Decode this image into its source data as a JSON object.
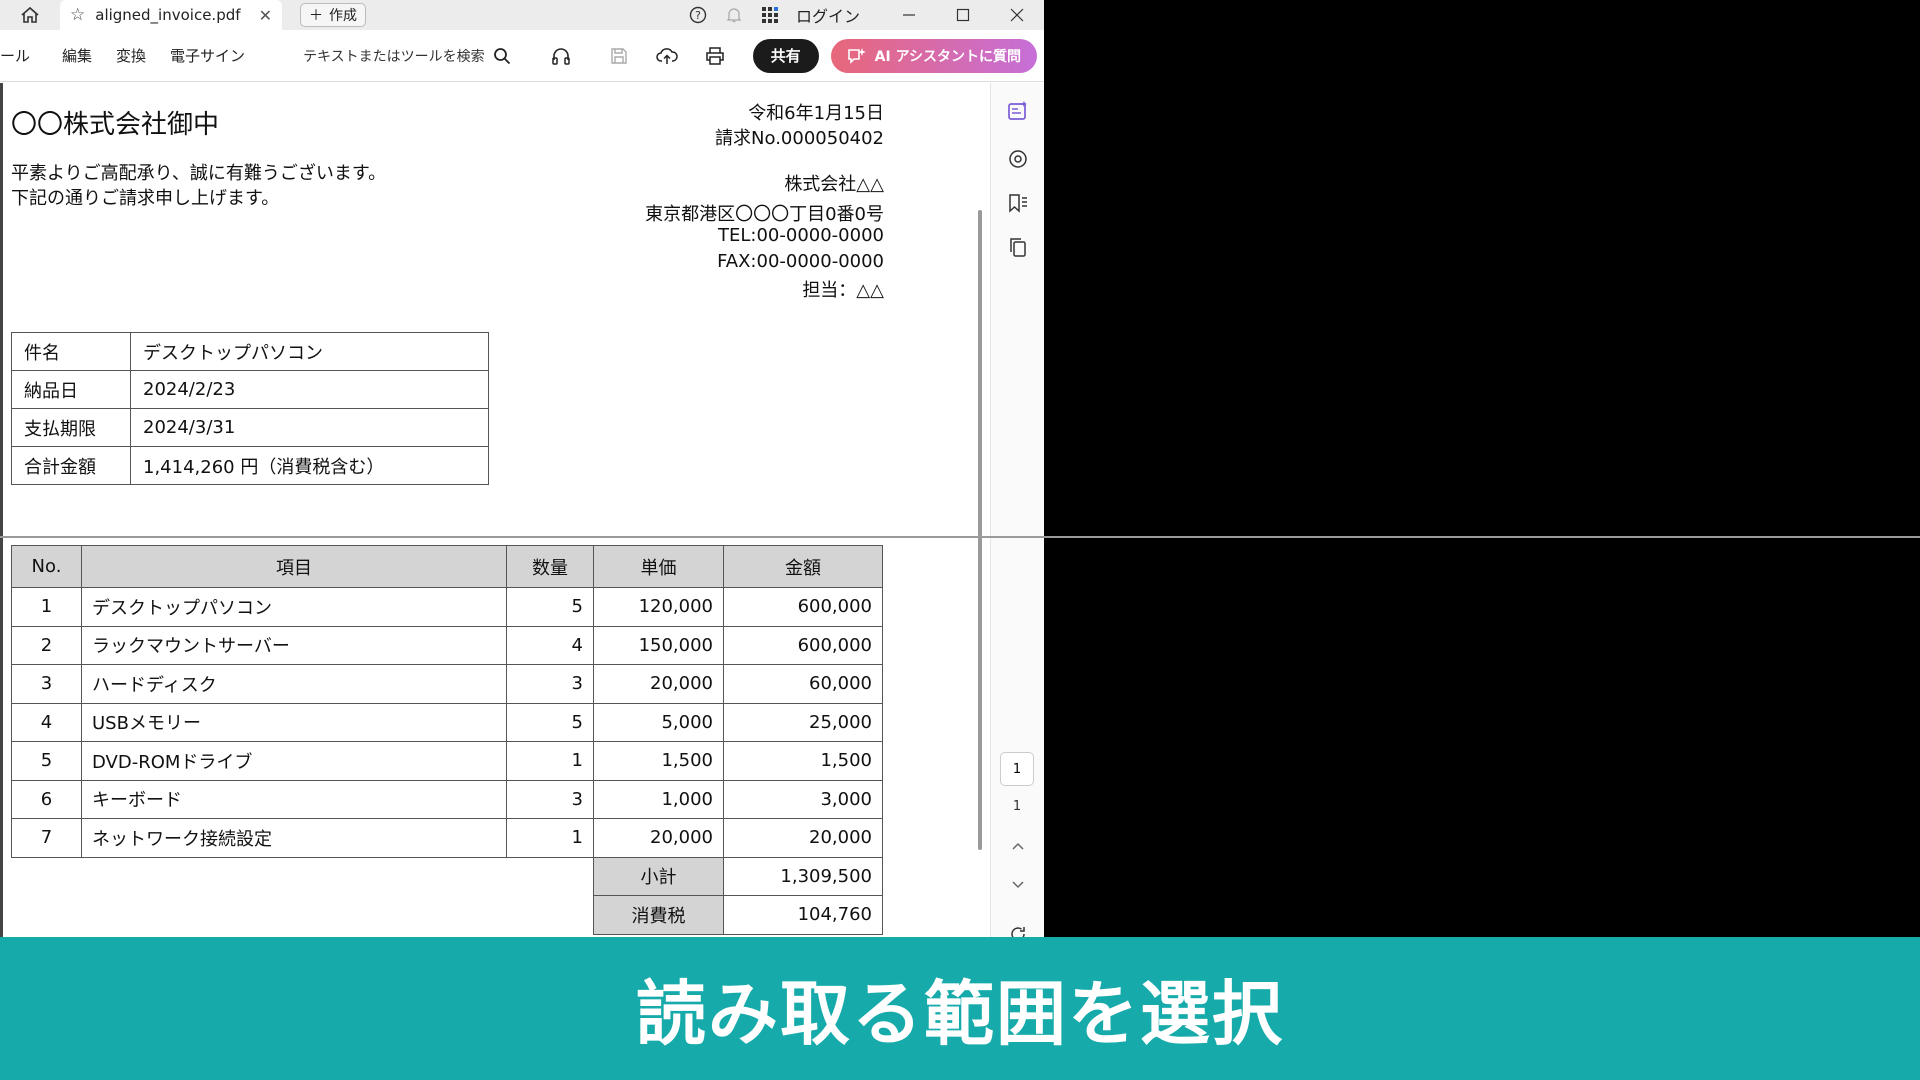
{
  "titlebar": {
    "tab_title": "aligned_invoice.pdf",
    "new_tab": "作成",
    "login": "ログイン"
  },
  "toolbar": {
    "menu": [
      "ール",
      "編集",
      "変換",
      "電子サイン"
    ],
    "search_placeholder": "テキストまたはツールを検索",
    "share": "共有",
    "ai": "AI アシスタントに質問"
  },
  "invoice": {
    "addressee": "〇〇株式会社御中",
    "date": "令和6年1月15日",
    "number": "請求No.000050402",
    "greeting1": "平素よりご高配承り、誠に有難うございます。",
    "greeting2": "下記の通りご請求申し上げます。",
    "company": "株式会社△△",
    "address": "東京都港区〇〇〇丁目0番0号",
    "tel": "TEL:00-0000-0000",
    "fax": "FAX:00-0000-0000",
    "contact": "担当：△△",
    "info": [
      {
        "label": "件名",
        "value": "デスクトップパソコン"
      },
      {
        "label": "納品日",
        "value": "2024/2/23"
      },
      {
        "label": "支払期限",
        "value": "2024/3/31"
      },
      {
        "label": "合計金額",
        "value": "1,414,260 円（消費税含む）"
      }
    ],
    "headers": {
      "no": "No.",
      "item": "項目",
      "qty": "数量",
      "price": "単価",
      "amount": "金額"
    },
    "rows": [
      {
        "no": "1",
        "item": "デスクトップパソコン",
        "qty": "5",
        "price": "120,000",
        "amount": "600,000"
      },
      {
        "no": "2",
        "item": "ラックマウントサーバー",
        "qty": "4",
        "price": "150,000",
        "amount": "600,000"
      },
      {
        "no": "3",
        "item": "ハードディスク",
        "qty": "3",
        "price": "20,000",
        "amount": "60,000"
      },
      {
        "no": "4",
        "item": "USBメモリー",
        "qty": "5",
        "price": "5,000",
        "amount": "25,000"
      },
      {
        "no": "5",
        "item": "DVD-ROMドライブ",
        "qty": "1",
        "price": "1,500",
        "amount": "1,500"
      },
      {
        "no": "6",
        "item": "キーボード",
        "qty": "3",
        "price": "1,000",
        "amount": "3,000"
      },
      {
        "no": "7",
        "item": "ネットワーク接続設定",
        "qty": "1",
        "price": "20,000",
        "amount": "20,000"
      }
    ],
    "subtotal_label": "小計",
    "subtotal": "1,309,500",
    "tax_label": "消費税",
    "tax": "104,760"
  },
  "pager": {
    "current": "1",
    "total": "1"
  },
  "caption": "読み取る範囲を選択"
}
